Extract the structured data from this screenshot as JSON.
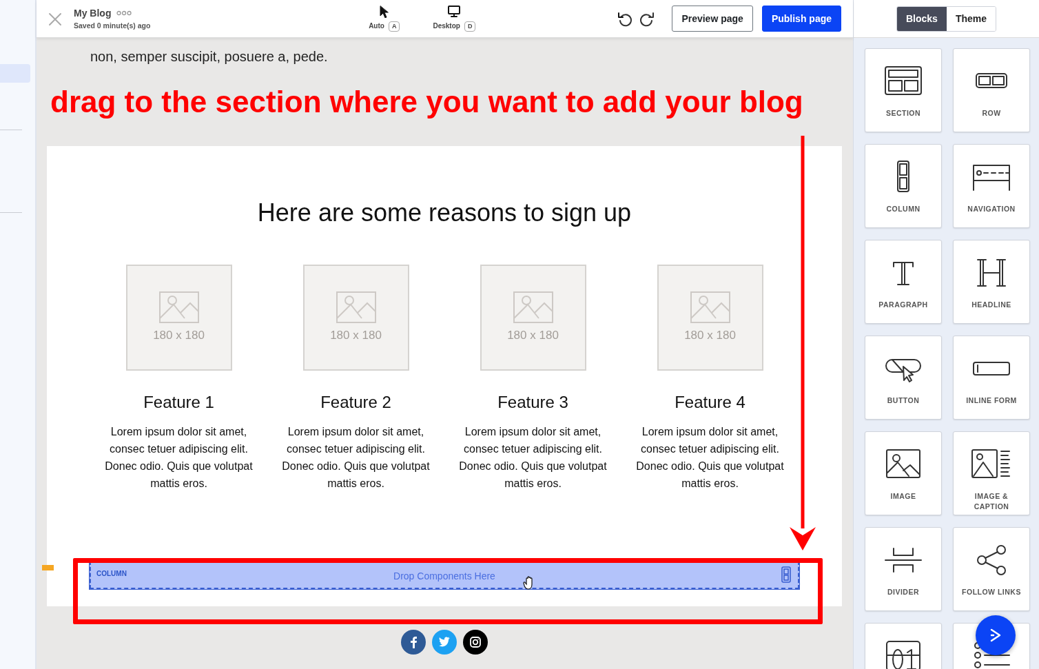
{
  "topbar": {
    "title": "My Blog",
    "saved": "Saved 0 minute(s) ago",
    "devices": [
      {
        "label": "Auto",
        "key": "A",
        "kind": "pointer"
      },
      {
        "label": "Desktop",
        "key": "D",
        "kind": "monitor"
      }
    ],
    "buttons": [
      {
        "label": "Preview page",
        "kind": "secondary"
      },
      {
        "label": "Publish page",
        "kind": "primary"
      }
    ]
  },
  "panel": {
    "tabs": [
      {
        "label": "Blocks",
        "selected": true
      },
      {
        "label": "Theme",
        "selected": false
      }
    ],
    "blocks": [
      {
        "label": "SECTION",
        "kind": "section"
      },
      {
        "label": "ROW",
        "kind": "row"
      },
      {
        "label": "COLUMN",
        "kind": "column"
      },
      {
        "label": "NAVIGATION",
        "kind": "navigation"
      },
      {
        "label": "PARAGRAPH",
        "kind": "paragraph"
      },
      {
        "label": "HEADLINE",
        "kind": "headline"
      },
      {
        "label": "BUTTON",
        "kind": "button"
      },
      {
        "label": "INLINE FORM",
        "kind": "form"
      },
      {
        "label": "IMAGE",
        "kind": "image"
      },
      {
        "label": "IMAGE & CAPTION",
        "kind": "caption"
      },
      {
        "label": "DIVIDER",
        "kind": "divider"
      },
      {
        "label": "FOLLOW LINKS",
        "kind": "share"
      },
      {
        "kind": "counter"
      },
      {
        "kind": "list"
      }
    ]
  },
  "canvas": {
    "intro_text": "non, semper suscipit, posuere a, pede.",
    "annotation": "drag to the section where you want to add your blog",
    "heading": "Here are some reasons to sign up",
    "features": [
      {
        "placeholder": "180 x 180",
        "title": "Feature 1",
        "text": "Lorem ipsum dolor sit amet, consec tetuer adipiscing elit. Donec odio. Quis que volutpat mattis eros."
      },
      {
        "placeholder": "180 x 180",
        "title": "Feature 2",
        "text": "Lorem ipsum dolor sit amet, consec tetuer adipiscing elit. Donec odio. Quis que volutpat mattis eros."
      },
      {
        "placeholder": "180 x 180",
        "title": "Feature 3",
        "text": "Lorem ipsum dolor sit amet, consec tetuer adipiscing elit. Donec odio. Quis que volutpat mattis eros."
      },
      {
        "placeholder": "180 x 180",
        "title": "Feature 4",
        "text": "Lorem ipsum dolor sit amet, consec tetuer adipiscing elit. Donec odio. Quis que volutpat mattis eros."
      }
    ],
    "drop_zone": {
      "label": "COLUMN",
      "hint": "Drop Components Here"
    },
    "social": [
      {
        "kind": "facebook"
      },
      {
        "kind": "twitter"
      },
      {
        "kind": "instagram"
      }
    ]
  }
}
